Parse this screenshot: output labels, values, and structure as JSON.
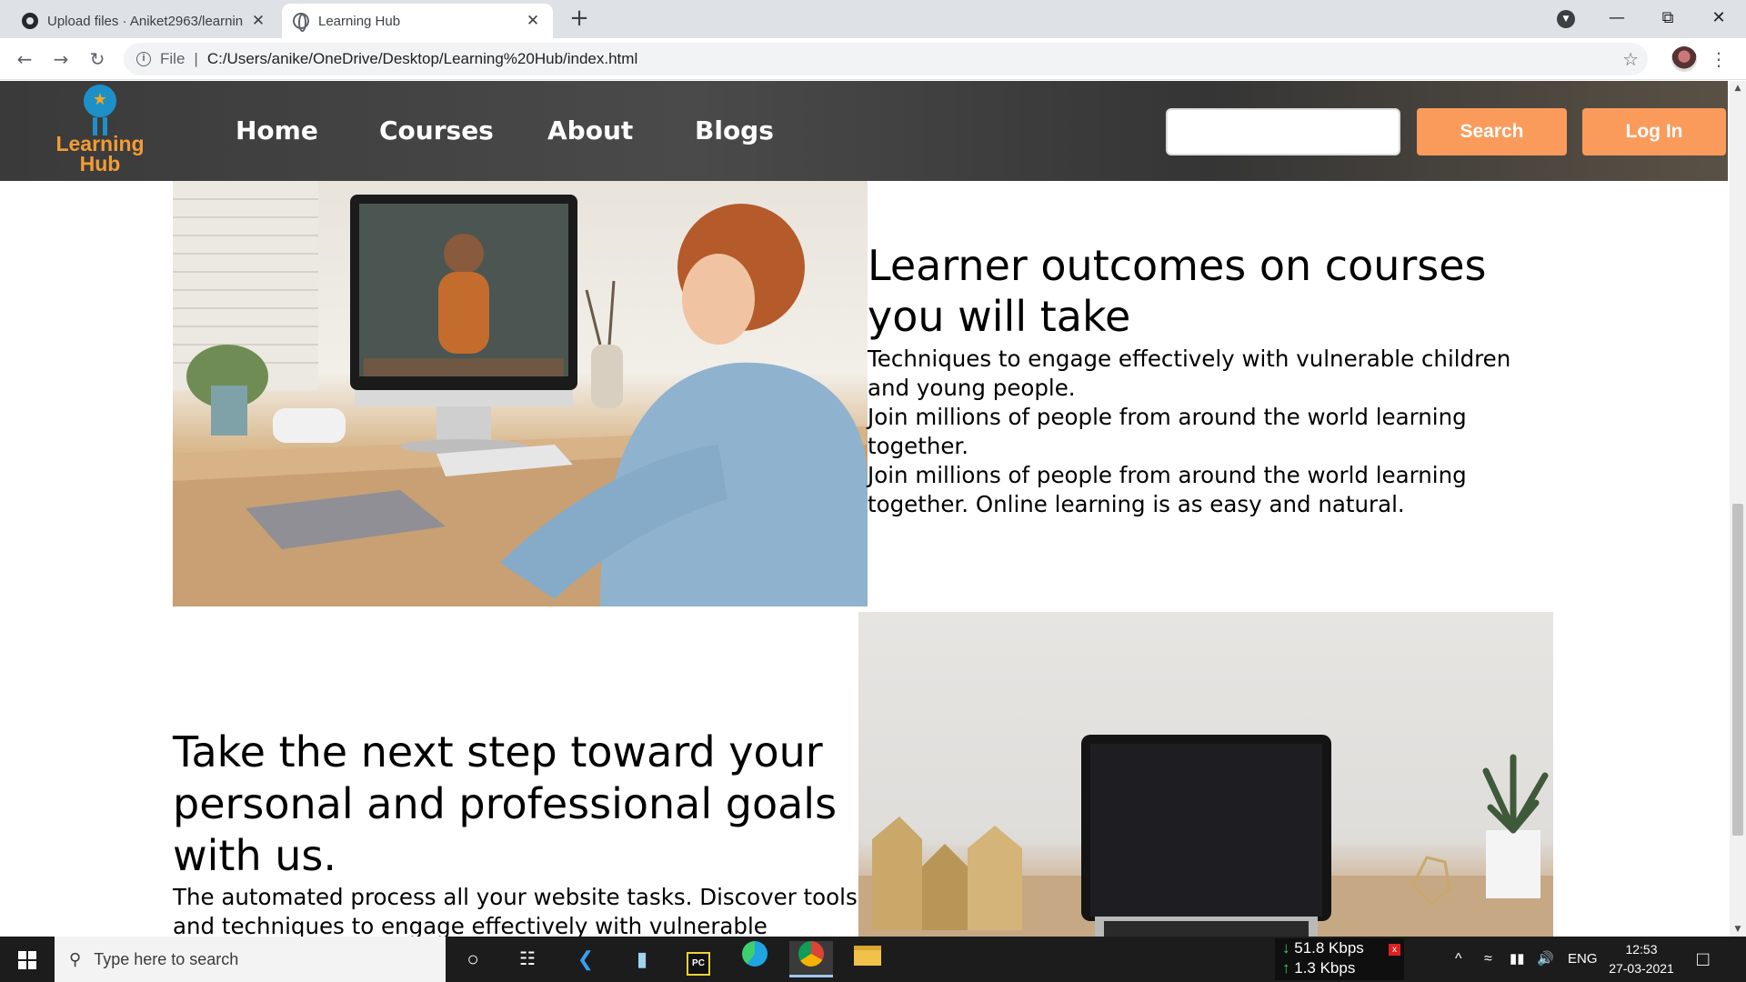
{
  "browser": {
    "tabs": [
      {
        "title": "Upload files · Aniket2963/learnin",
        "active": false
      },
      {
        "title": "Learning Hub",
        "active": true
      }
    ],
    "address": {
      "scheme_label": "File",
      "url": "C:/Users/anike/OneDrive/Desktop/Learning%20Hub/index.html"
    }
  },
  "site": {
    "logo": {
      "line1": "Learning",
      "line2": "Hub"
    },
    "nav": [
      "Home",
      "Courses",
      "About",
      "Blogs"
    ],
    "search_button": "Search",
    "login_button": "Log In",
    "search_value": ""
  },
  "section1": {
    "heading": "Learner outcomes on courses you will take",
    "lines": [
      "Techniques to engage effectively with vulnerable children and young people.",
      "Join millions of people from around the world learning together.",
      "Join millions of people from around the world learning together. Online learning is as easy and natural."
    ]
  },
  "section2": {
    "heading": "Take the next step toward your personal and professional goals with us.",
    "text": "The automated process all your website tasks. Discover tools and techniques to engage effectively with vulnerable"
  },
  "taskbar": {
    "search_placeholder": "Type here to search",
    "net_down": "51.8 Kbps",
    "net_up": "1.3 Kbps",
    "language": "ENG",
    "time": "12:53",
    "date": "27-03-2021"
  },
  "colors": {
    "accent_orange": "#fa9b5c",
    "logo_orange": "#f39c35",
    "logo_blue": "#1e90c8",
    "nav_bg": "#3a3a3a"
  }
}
